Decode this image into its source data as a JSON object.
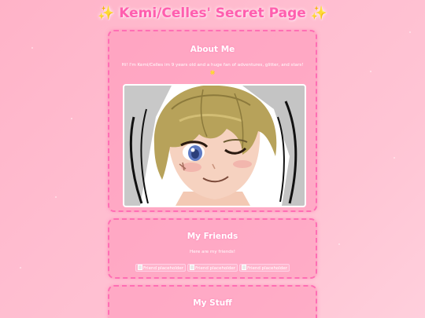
{
  "site": {
    "title": "✨ Kemi/Celles' Secret Page ✨"
  },
  "about": {
    "heading": "About Me",
    "text": "Hi! I'm Kemi/Celles im 9 years old and a huge fan of adventures, glitter, and stars! 🌟"
  },
  "friends": {
    "heading": "My Friends",
    "subtitle": "Here are my friends!",
    "items": [
      {
        "alt": "Friend placeholder"
      },
      {
        "alt": "Friend placeholder"
      },
      {
        "alt": "Friend placeholder"
      }
    ]
  },
  "stuff": {
    "heading": "My Stuff"
  },
  "colors": {
    "background": "#ffbdd0",
    "title": "#ff5fae",
    "panel_border": "#ff6eb4"
  }
}
